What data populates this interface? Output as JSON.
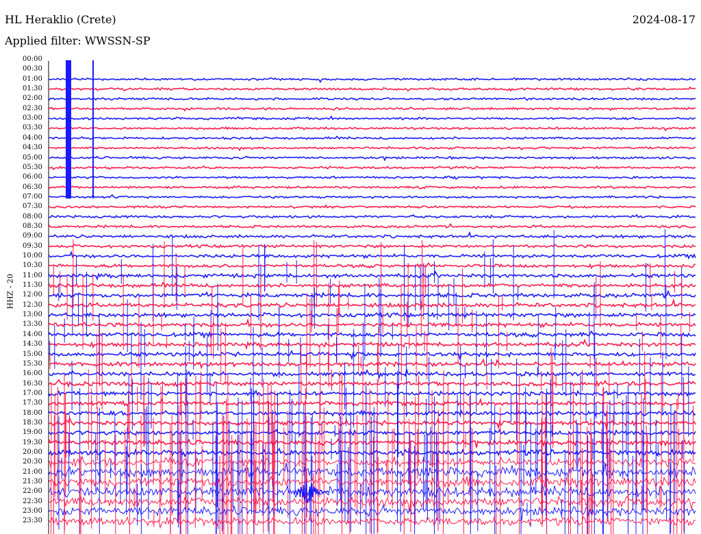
{
  "header": {
    "station": "HL Heraklio (Crete)",
    "filter": "Applied filter: WWSSN-SP",
    "date": "2024-08-17"
  },
  "channel": "HHZ - 20",
  "colors": {
    "trace_a": "#1a1aff",
    "trace_b": "#ff1a4b",
    "axis": "#000000"
  },
  "chart_data": {
    "type": "line",
    "title": "HL Heraklio (Crete)",
    "subtitle": "Applied filter: WWSSN-SP",
    "date": "2024-08-17",
    "ylabel": "HHZ - 20",
    "rows": [
      "00:00",
      "00:30",
      "01:00",
      "01:30",
      "02:00",
      "02:30",
      "03:00",
      "03:30",
      "04:00",
      "04:30",
      "05:00",
      "05:30",
      "06:00",
      "06:30",
      "07:00",
      "07:30",
      "08:00",
      "08:30",
      "09:00",
      "09:30",
      "10:00",
      "10:30",
      "11:00",
      "11:30",
      "12:00",
      "12:30",
      "13:00",
      "13:30",
      "14:00",
      "14:30",
      "15:00",
      "15:30",
      "16:00",
      "16:30",
      "17:00",
      "17:30",
      "18:00",
      "18:30",
      "19:00",
      "19:30",
      "20:00",
      "20:30",
      "21:00",
      "21:30",
      "22:00",
      "22:30",
      "23:00",
      "23:30"
    ],
    "row_minutes": 30,
    "series_colors": [
      "#1a1aff",
      "#ff1a4b"
    ],
    "noise_level": [
      0,
      0,
      0.6,
      0.6,
      0.6,
      0.6,
      0.6,
      0.6,
      0.6,
      0.6,
      0.6,
      0.6,
      0.6,
      0.6,
      0.6,
      0.6,
      0.7,
      0.7,
      0.8,
      0.8,
      0.9,
      0.9,
      1.0,
      1.0,
      1.1,
      1.1,
      1.1,
      1.1,
      1.1,
      1.1,
      1.1,
      1.1,
      1.1,
      1.1,
      1.1,
      1.1,
      1.2,
      1.2,
      1.2,
      1.3,
      1.4,
      2.2,
      2.6,
      2.8,
      2.8,
      2.6,
      2.4,
      2.2
    ],
    "events": [
      {
        "row": "22:00",
        "minute": 12,
        "label": ""
      }
    ]
  }
}
